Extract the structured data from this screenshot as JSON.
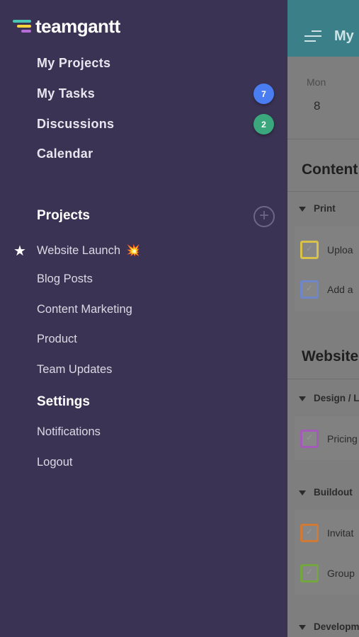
{
  "brand": {
    "name": "teamgantt"
  },
  "nav": [
    {
      "label": "My Projects",
      "badge": null
    },
    {
      "label": "My Tasks",
      "badge": "7",
      "badge_color": "#4a7cf2"
    },
    {
      "label": "Discussions",
      "badge": "2",
      "badge_color": "#3aa77d"
    },
    {
      "label": "Calendar",
      "badge": null
    }
  ],
  "projects_section": {
    "title": "Projects",
    "add_icon": "plus-circle-icon"
  },
  "projects": [
    {
      "label": "Website Launch",
      "starred": true,
      "emoji": "💥"
    },
    {
      "label": "Blog Posts"
    },
    {
      "label": "Content Marketing"
    },
    {
      "label": "Product"
    },
    {
      "label": "Team Updates"
    }
  ],
  "settings_section": {
    "title": "Settings"
  },
  "settings": [
    {
      "label": "Notifications"
    },
    {
      "label": "Logout"
    }
  ],
  "background": {
    "header_title": "My",
    "header_color": "#3b7f89",
    "day": "Mon",
    "date": "8",
    "project1": {
      "title": "Content",
      "groups": [
        {
          "label": "Print"
        }
      ],
      "tasks": [
        {
          "label": "Uploa",
          "color": "#d8c24a"
        },
        {
          "label": "Add a",
          "color": "#6f86c9"
        }
      ]
    },
    "project2": {
      "title": "Website",
      "groups": [
        {
          "label": "Design / L"
        },
        {
          "label": "Buildout"
        },
        {
          "label": "Developm"
        }
      ],
      "tasks": [
        {
          "label": "Pricing",
          "color": "#a45ab8"
        },
        {
          "label": "Invitat",
          "color": "#d07a35"
        },
        {
          "label": "Group",
          "color": "#74a640"
        }
      ]
    }
  }
}
